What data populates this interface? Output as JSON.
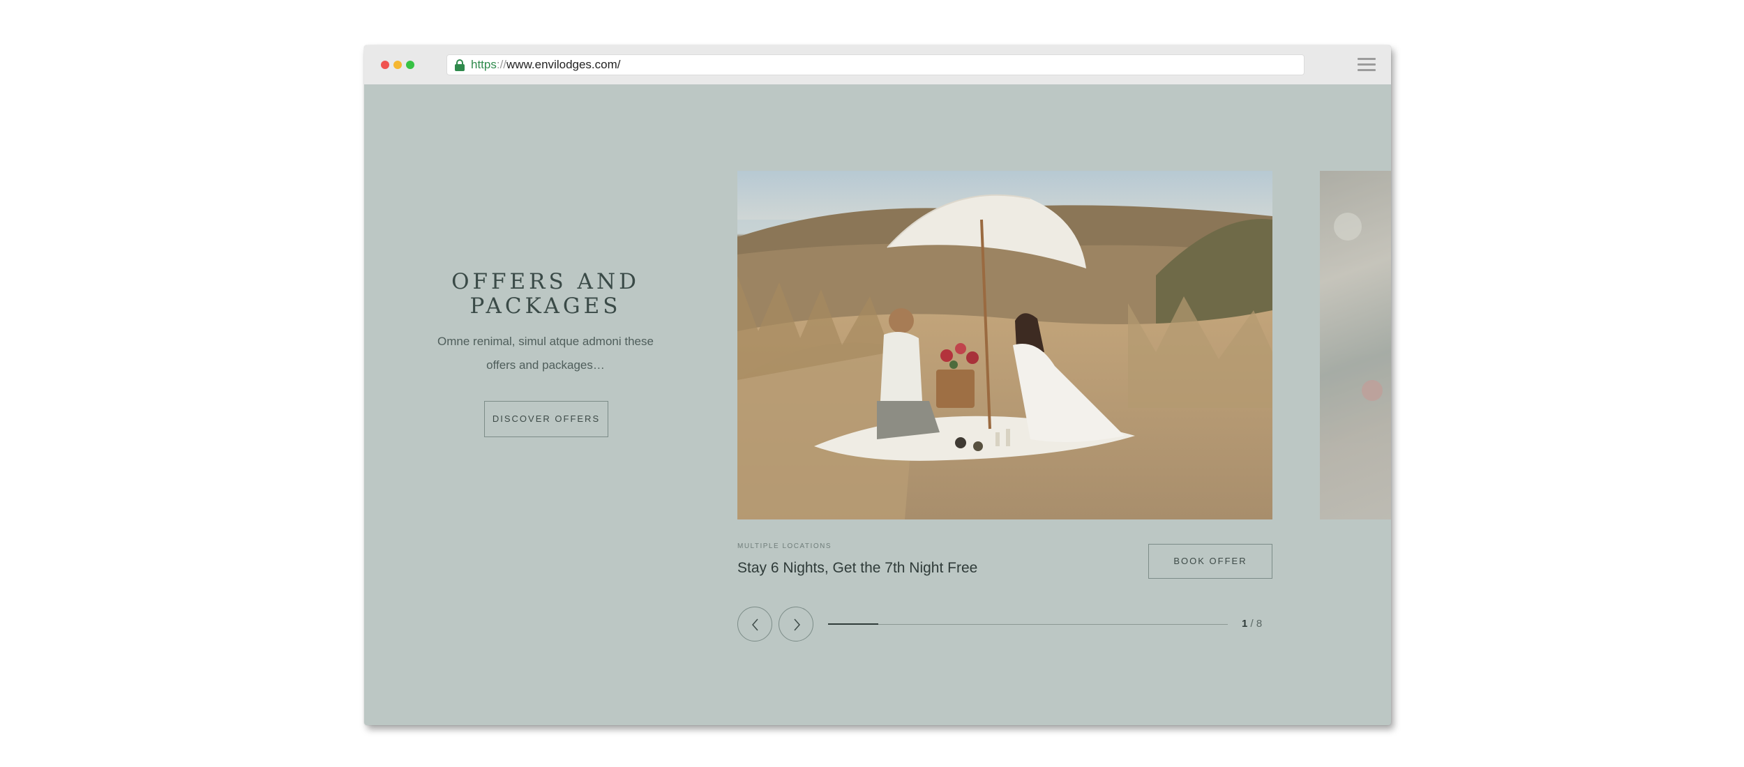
{
  "browser": {
    "url_scheme": "https",
    "url_separator": "://",
    "url_host": "www.envilodges.com/",
    "icons": {
      "lock": "lock-icon",
      "menu": "hamburger-menu-icon"
    }
  },
  "hero": {
    "title_line1": "OFFERS AND",
    "title_line2": "PACKAGES",
    "description_line1": "Omne renimal, simul atque admoni these",
    "description_line2": "offers and packages…",
    "button_label": "DISCOVER OFFERS"
  },
  "slide": {
    "location": "MULTIPLE LOCATIONS",
    "title": "Stay 6 Nights, Get the 7th Night Free",
    "button_label": "BOOK OFFER",
    "image_alt": "Couple having a picnic under a white umbrella in sand dunes"
  },
  "slider": {
    "current": "1",
    "separator": " / ",
    "total": "8",
    "progress_fraction": 0.125,
    "icons": {
      "prev": "chevron-left-icon",
      "next": "chevron-right-icon"
    }
  },
  "colors": {
    "page_background": "#bcc7c4",
    "text_dark": "#2f3b39",
    "secure_green": "#2f8a4c"
  }
}
